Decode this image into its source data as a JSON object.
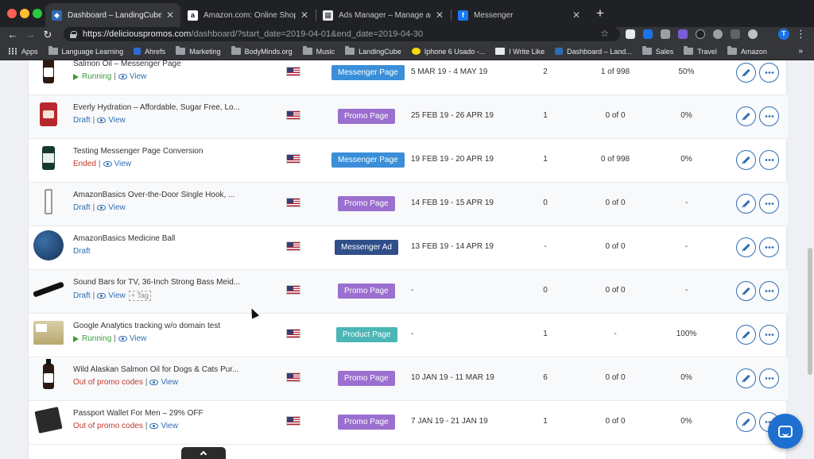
{
  "browser": {
    "tabs": [
      {
        "title": "Dashboard – LandingCube",
        "active": true,
        "icon": "landingcube-icon"
      },
      {
        "title": "Amazon.com: Online Shopping",
        "active": false,
        "icon": "amazon-icon"
      },
      {
        "title": "Ads Manager – Manage ads - ",
        "active": false,
        "icon": "ads-manager-icon"
      },
      {
        "title": "Messenger",
        "active": false,
        "icon": "facebook-icon"
      }
    ],
    "url_host": "https://deliciouspromos.com",
    "url_path": "/dashboard/?start_date=2019-04-01&end_date=2019-04-30",
    "profile_initial": "T",
    "bookmarks": [
      {
        "label": "Apps",
        "icon": "apps-grid-icon"
      },
      {
        "label": "Language Learning",
        "icon": "folder-icon"
      },
      {
        "label": "Ahrefs",
        "icon": "ahrefs-icon"
      },
      {
        "label": "Marketing",
        "icon": "folder-icon"
      },
      {
        "label": "BodyMinds.org",
        "icon": "folder-icon"
      },
      {
        "label": "Music",
        "icon": "folder-icon"
      },
      {
        "label": "LandingCube",
        "icon": "folder-icon"
      },
      {
        "label": "Iphone 6 Usado -...",
        "icon": "mercadolivre-icon"
      },
      {
        "label": "I Write Like",
        "icon": "iwl-icon"
      },
      {
        "label": "Dashboard – Land...",
        "icon": "landingcube-icon"
      },
      {
        "label": "Sales",
        "icon": "folder-icon"
      },
      {
        "label": "Travel",
        "icon": "folder-icon"
      },
      {
        "label": "Amazon",
        "icon": "folder-icon"
      }
    ],
    "more_bookmarks": "»"
  },
  "status_labels": {
    "running": "Running",
    "draft": "Draft",
    "ended": "Ended",
    "out_of_codes": "Out of promo codes",
    "view": "View",
    "tag": "+ Tag",
    "separator": "|"
  },
  "rows": [
    {
      "name": "Salmon Oil – Messenger Page",
      "status": "running",
      "thumb": "bottle",
      "page_type": "Messenger Page",
      "type_class": "pt-messenger-page",
      "dates": "5 MAR 19 - 4 MAY 19",
      "clicks": "2",
      "codes": "1 of 998",
      "rate": "50%",
      "has_tag": false
    },
    {
      "name": "Everly Hydration – Affordable, Sugar Free, Lo...",
      "status": "draft",
      "thumb": "pouch",
      "page_type": "Promo Page",
      "type_class": "pt-promo-page",
      "dates": "25 FEB 19 - 26 APR 19",
      "clicks": "1",
      "codes": "0 of 0",
      "rate": "0%",
      "has_tag": false
    },
    {
      "name": "Testing Messenger Page Conversion",
      "status": "ended",
      "thumb": "jar",
      "page_type": "Messenger Page",
      "type_class": "pt-messenger-page",
      "dates": "19 FEB 19 - 20 APR 19",
      "clicks": "1",
      "codes": "0 of 998",
      "rate": "0%",
      "has_tag": false
    },
    {
      "name": "AmazonBasics Over-the-Door Single Hook, ...",
      "status": "draft",
      "thumb": "hook",
      "page_type": "Promo Page",
      "type_class": "pt-promo-page",
      "dates": "14 FEB 19 - 15 APR 19",
      "clicks": "0",
      "codes": "0 of 0",
      "rate": "-",
      "has_tag": false
    },
    {
      "name": "AmazonBasics Medicine Ball",
      "status": "draft_only",
      "thumb": "ball",
      "page_type": "Messenger Ad",
      "type_class": "pt-messenger-ad",
      "dates": "13 FEB 19 - 14 APR 19",
      "clicks": "-",
      "codes": "0 of 0",
      "rate": "-",
      "has_tag": false
    },
    {
      "name": "Sound Bars for TV, 36-Inch Strong Bass Meid...",
      "status": "draft",
      "thumb": "soundbar",
      "page_type": "Promo Page",
      "type_class": "pt-promo-page",
      "dates": "-",
      "clicks": "0",
      "codes": "0 of 0",
      "rate": "-",
      "has_tag": true
    },
    {
      "name": "Google Analytics tracking w/o domain test",
      "status": "running",
      "thumb": "boxes",
      "page_type": "Product Page",
      "type_class": "pt-product-page",
      "dates": "-",
      "clicks": "1",
      "codes": "-",
      "rate": "100%",
      "has_tag": false
    },
    {
      "name": "Wild Alaskan Salmon Oil for Dogs & Cats Pur...",
      "status": "out_of_codes",
      "thumb": "bottle",
      "page_type": "Promo Page",
      "type_class": "pt-promo-page",
      "dates": "10 JAN 19 - 11 MAR 19",
      "clicks": "6",
      "codes": "0 of 0",
      "rate": "0%",
      "has_tag": false
    },
    {
      "name": "Passport Wallet For Men – 29% OFF",
      "status": "out_of_codes",
      "thumb": "wallet",
      "page_type": "Promo Page",
      "type_class": "pt-promo-page",
      "dates": "7 JAN 19 - 21 JAN 19",
      "clicks": "1",
      "codes": "0 of 0",
      "rate": "0%",
      "has_tag": false
    }
  ],
  "colors": {
    "running": "#3d9b3d",
    "draft": "#2e6db3",
    "ended": "#c0392b",
    "messenger_page": "#3a8fd8",
    "promo_page": "#9b6fcf",
    "messenger_ad": "#2f4e8a",
    "product_page": "#4bb6b6"
  }
}
